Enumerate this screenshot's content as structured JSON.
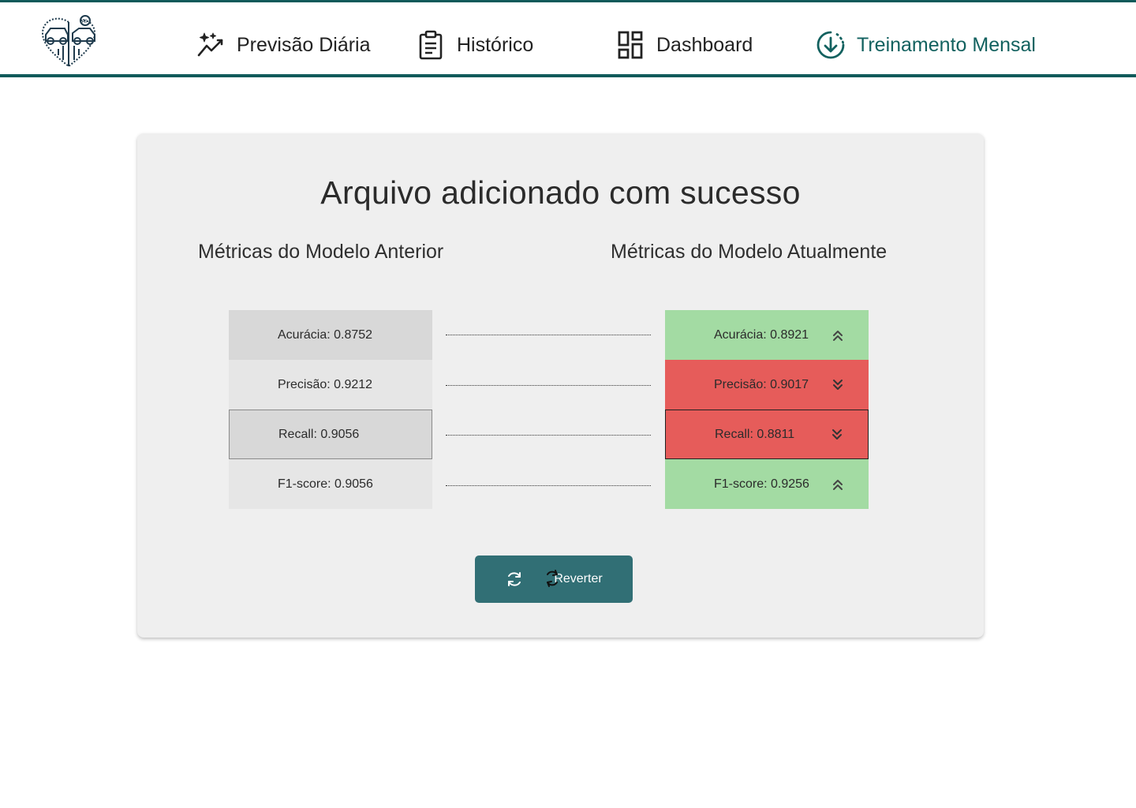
{
  "header": {
    "logo_text": "AI",
    "nav": [
      {
        "label": "Previsão Diária",
        "icon": "sparkle-trend-icon",
        "active": false
      },
      {
        "label": "Histórico",
        "icon": "clipboard-icon",
        "active": false
      },
      {
        "label": "Dashboard",
        "icon": "dashboard-grid-icon",
        "active": false
      },
      {
        "label": "Treinamento Mensal",
        "icon": "download-circle-icon",
        "active": true
      }
    ]
  },
  "card": {
    "title": "Arquivo adicionado com sucesso",
    "left_title": "Métricas do Modelo Anterior",
    "right_title": "Métricas do Modelo Atualmente",
    "previous_metrics": [
      {
        "label": "Acurácia: 0.8752"
      },
      {
        "label": "Precisão: 0.9212"
      },
      {
        "label": "Recall: 0.9056"
      },
      {
        "label": "F1-score: 0.9056"
      }
    ],
    "current_metrics": [
      {
        "label": "Acurácia: 0.8921",
        "trend": "up",
        "color": "#a3dba3"
      },
      {
        "label": "Precisão: 0.9017",
        "trend": "down",
        "color": "#e65c5a"
      },
      {
        "label": "Recall: 0.8811",
        "trend": "down",
        "color": "#e65c5a"
      },
      {
        "label": "F1-score: 0.9256",
        "trend": "up",
        "color": "#a3dba3"
      }
    ],
    "revert_button_label": "Reverter"
  },
  "colors": {
    "brand": "#0f5a5a",
    "button": "#316f75",
    "improve": "#a3dba3",
    "worse": "#e65c5a",
    "card_bg": "#efefef"
  }
}
